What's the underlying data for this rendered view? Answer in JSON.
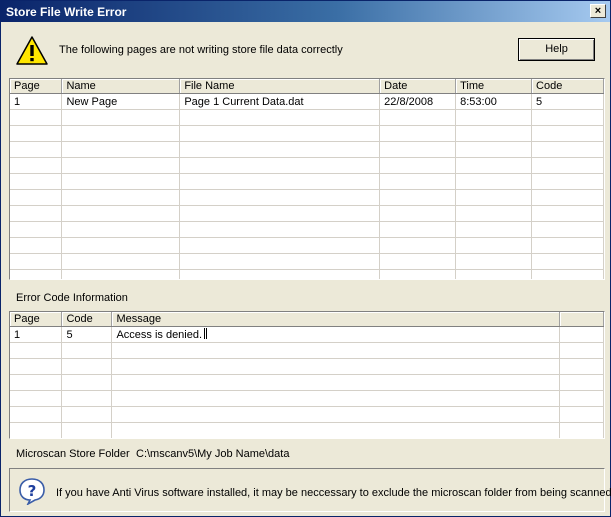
{
  "window": {
    "title": "Store File Write Error",
    "close_label": "×"
  },
  "header": {
    "message": "The following pages are not writing store file data correctly",
    "help_label": "Help",
    "icon": "warning-icon"
  },
  "pages_table": {
    "columns": [
      "Page",
      "Name",
      "File Name",
      "Date",
      "Time",
      "Code"
    ],
    "rows": [
      [
        "1",
        "New Page",
        "Page 1 Current Data.dat",
        "22/8/2008",
        "8:53:00",
        "5"
      ]
    ]
  },
  "error_section": {
    "label": "Error Code Information",
    "columns": [
      "Page",
      "Code",
      "Message"
    ],
    "rows": [
      [
        "1",
        "5",
        "Access is denied."
      ]
    ]
  },
  "folder": {
    "label": "Microscan Store Folder",
    "path": "C:\\mscanv5\\My Job Name\\data"
  },
  "info": {
    "icon": "question-icon",
    "text": "If you have Anti Virus software installed, it may be neccessary to exclude the microscan folder from being scanned."
  }
}
